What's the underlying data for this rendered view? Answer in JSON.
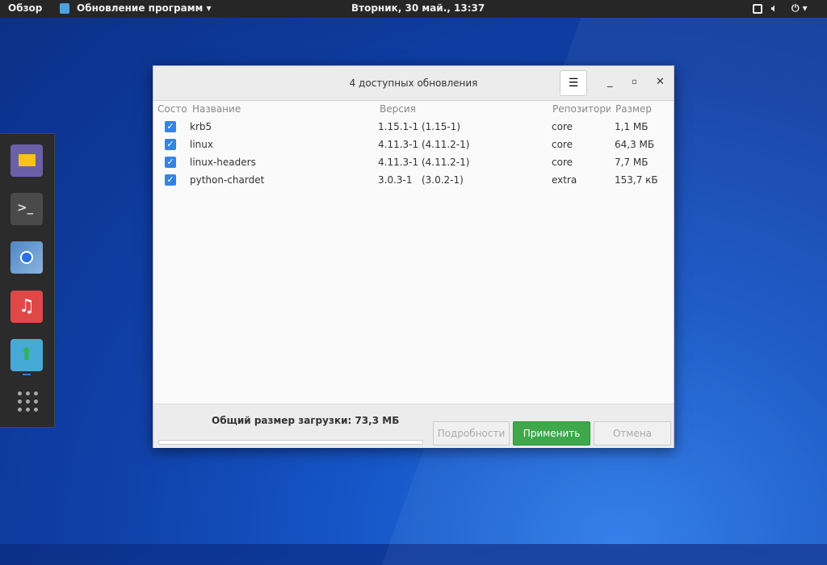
{
  "topbar": {
    "activities": "Обзор",
    "app_menu": "Обновление программ ▾",
    "clock": "Вторник, 30 май., 13:37"
  },
  "dock": {
    "items": [
      "files",
      "terminal",
      "chromium",
      "music",
      "software-update"
    ]
  },
  "window": {
    "title": "4 доступных обновления",
    "columns": [
      "Состоя",
      "Название",
      "Версия",
      "Репозитори",
      "Размер"
    ],
    "rows": [
      {
        "checked": true,
        "name": "krb5",
        "version": "1.15.1-1 (1.15-1)",
        "repo": "core",
        "size": "1,1 МБ"
      },
      {
        "checked": true,
        "name": "linux",
        "version": "4.11.3-1 (4.11.2-1)",
        "repo": "core",
        "size": "64,3 МБ"
      },
      {
        "checked": true,
        "name": "linux-headers",
        "version": "4.11.3-1 (4.11.2-1)",
        "repo": "core",
        "size": "7,7 МБ"
      },
      {
        "checked": true,
        "name": "python-chardet",
        "version": "3.0.3-1   (3.0.2-1)",
        "repo": "extra",
        "size": "153,7 кБ"
      }
    ],
    "total": "Общий размер загрузки: 73,3 МБ",
    "progress": 0,
    "buttons": {
      "details": "Подробности",
      "apply": "Применить",
      "cancel": "Отмена"
    }
  }
}
